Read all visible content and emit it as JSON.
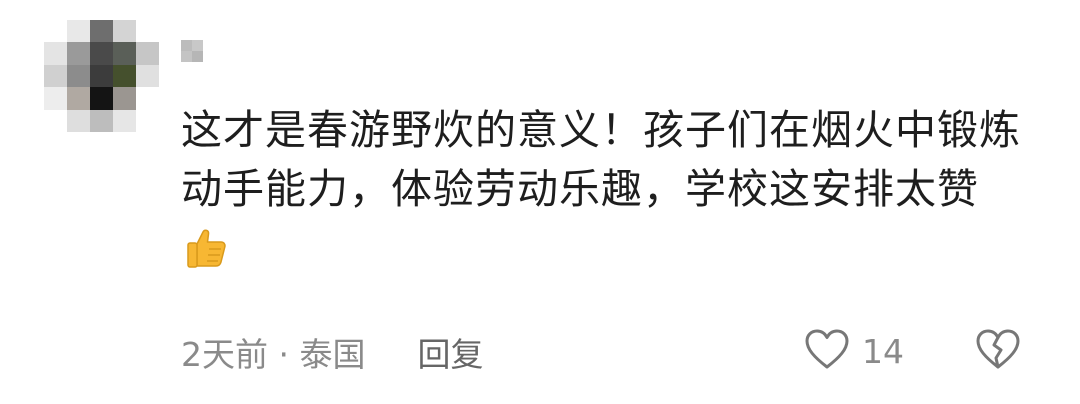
{
  "comment": {
    "avatar_icon": "pixelated-avatar-icon",
    "username_icon": "pixelated-username-icon",
    "text": "这才是春游野炊的意义！孩子们在烟火中锻炼动手能力，体验劳动乐趣，学校这安排太赞",
    "emoji": "thumbs-up-emoji-icon",
    "time": "2天前",
    "separator": " · ",
    "location": "泰国",
    "reply_label": "回复",
    "like_icon": "heart-outline-icon",
    "like_count": "14",
    "dislike_icon": "broken-heart-outline-icon",
    "colors": {
      "text": "#1e1e1e",
      "meta": "#8a8a8a",
      "icon_stroke": "#777777",
      "emoji": "#f7b733"
    }
  }
}
